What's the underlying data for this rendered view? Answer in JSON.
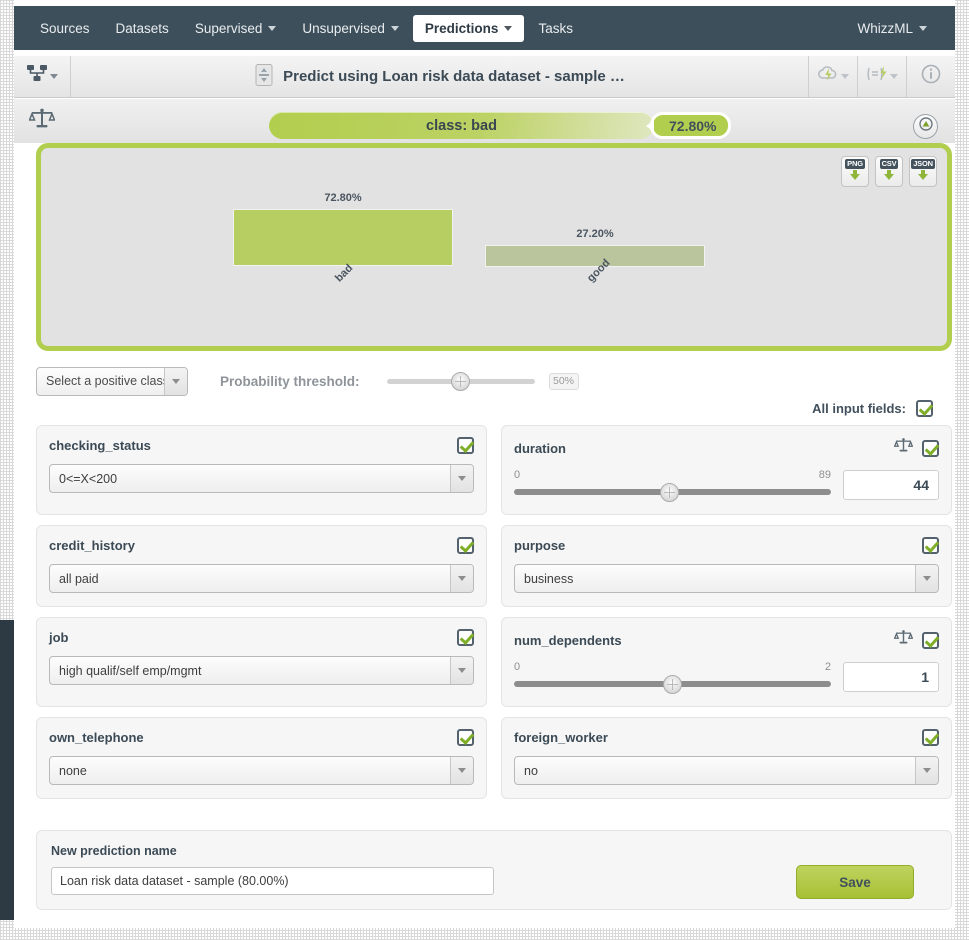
{
  "nav": {
    "items": [
      {
        "label": "Sources",
        "dropdown": false,
        "active": false
      },
      {
        "label": "Datasets",
        "dropdown": false,
        "active": false
      },
      {
        "label": "Supervised",
        "dropdown": true,
        "active": false
      },
      {
        "label": "Unsupervised",
        "dropdown": true,
        "active": false
      },
      {
        "label": "Predictions",
        "dropdown": true,
        "active": true
      },
      {
        "label": "Tasks",
        "dropdown": false,
        "active": false
      }
    ],
    "right": {
      "label": "WhizzML",
      "dropdown": true
    }
  },
  "toolbar": {
    "model_icon": "model-tree-icon",
    "title_icon": "prediction-icon",
    "title": "Predict using Loan risk data dataset - sample …",
    "actions": [
      {
        "icon": "cloud-lightning-icon",
        "dropdown": true
      },
      {
        "icon": "script-lightning-icon",
        "dropdown": true
      },
      {
        "icon": "info-icon",
        "dropdown": false
      }
    ]
  },
  "prediction_bar": {
    "scales_icon": "scales-icon",
    "class_label": "class: bad",
    "probability": "72.80%",
    "collapse_icon": "collapse-up-icon"
  },
  "chart_panel": {
    "exports": [
      {
        "label": "PNG",
        "icon": "download-arrow-icon"
      },
      {
        "label": "CSV",
        "icon": "download-arrow-icon"
      },
      {
        "label": "JSON",
        "icon": "download-arrow-icon"
      }
    ]
  },
  "chart_data": {
    "type": "bar",
    "title": "",
    "xlabel": "",
    "ylabel": "",
    "grid": false,
    "legend": "none",
    "ylim": [
      0,
      100
    ],
    "categories": [
      "bad",
      "good"
    ],
    "values": [
      72.8,
      27.2
    ],
    "labels": [
      "72.80%",
      "27.20%"
    ],
    "colors": [
      "#b7ce63",
      "#bac49d"
    ]
  },
  "threshold": {
    "positive_class_placeholder": "Select a positive class",
    "label": "Probability threshold:",
    "value": "50%",
    "slider_percent": 50
  },
  "all_fields": {
    "label": "All input fields:",
    "checked": true
  },
  "fields": [
    {
      "name": "checking_status",
      "type": "categorical",
      "value": "0<=X<200",
      "checked": true,
      "has_scales": false
    },
    {
      "name": "duration",
      "type": "numeric",
      "min": "0",
      "max": "89",
      "value": "44",
      "slider_percent": 49,
      "checked": true,
      "has_scales": true
    },
    {
      "name": "credit_history",
      "type": "categorical",
      "value": "all paid",
      "checked": true,
      "has_scales": false
    },
    {
      "name": "purpose",
      "type": "categorical",
      "value": "business",
      "checked": true,
      "has_scales": false
    },
    {
      "name": "job",
      "type": "categorical",
      "value": "high qualif/self emp/mgmt",
      "checked": true,
      "has_scales": false
    },
    {
      "name": "num_dependents",
      "type": "numeric",
      "min": "0",
      "max": "2",
      "value": "1",
      "slider_percent": 50,
      "checked": true,
      "has_scales": true
    },
    {
      "name": "own_telephone",
      "type": "categorical",
      "value": "none",
      "checked": true,
      "has_scales": false
    },
    {
      "name": "foreign_worker",
      "type": "categorical",
      "value": "no",
      "checked": true,
      "has_scales": false
    }
  ],
  "bottom": {
    "name_label": "New prediction name",
    "name_value": "Loan risk data dataset - sample (80.00%)",
    "save_label": "Save"
  },
  "colors": {
    "brand_green": "#b2ce4e",
    "nav_bg": "#3e4f5c",
    "bar_primary": "#b7ce63",
    "bar_secondary": "#bac49d"
  }
}
